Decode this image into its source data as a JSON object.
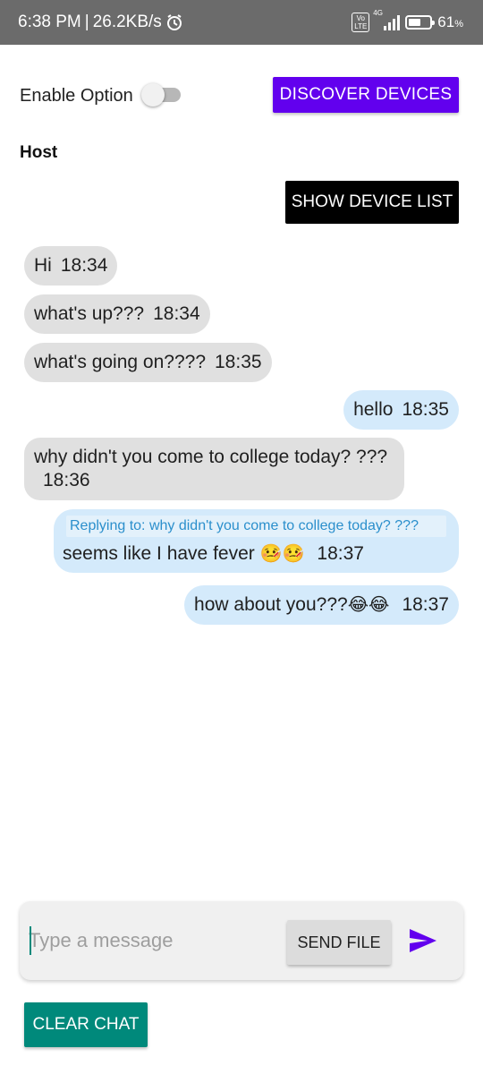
{
  "status_bar": {
    "time": "6:38 PM",
    "separator": "|",
    "speed": "26.2KB/s",
    "alarm_icon": "alarm-icon",
    "volte_label": "Vo LTE",
    "network_label": "4G",
    "battery_percent": 61,
    "battery_text": "61",
    "battery_unit": "%"
  },
  "controls": {
    "enable_option_label": "Enable Option",
    "enable_option_on": false,
    "discover_label": "DISCOVER DEVICES",
    "host_label": "Host",
    "show_device_list_label": "SHOW DEVICE LIST"
  },
  "messages": [
    {
      "direction": "incoming",
      "text": "Hi",
      "time": "18:34"
    },
    {
      "direction": "incoming",
      "text": "what's up???",
      "time": "18:34"
    },
    {
      "direction": "incoming",
      "text": "what's going on????",
      "time": "18:35"
    },
    {
      "direction": "outgoing",
      "text": "hello",
      "time": "18:35"
    },
    {
      "direction": "incoming",
      "text": "why didn't you come to college today? ???",
      "time": "18:36"
    },
    {
      "direction": "outgoing",
      "reply_to": "Replying to: why didn't you come to college today? ???",
      "text": "seems like I have fever",
      "emoji": "🤒🤒",
      "time": "18:37"
    },
    {
      "direction": "outgoing",
      "text": "how about you???",
      "emoji": "😂😂",
      "time": "18:37"
    }
  ],
  "composer": {
    "placeholder": "Type a message",
    "value": "",
    "send_file_label": "SEND FILE",
    "send_icon": "send-icon"
  },
  "clear_chat_label": "CLEAR CHAT",
  "colors": {
    "status_bar": "#6b6b6b",
    "accent_purple": "#6200ee",
    "teal": "#00897b",
    "incoming_bubble": "#e0e0e0",
    "outgoing_bubble": "#d4eafb",
    "reply_text": "#2b8fcc"
  }
}
